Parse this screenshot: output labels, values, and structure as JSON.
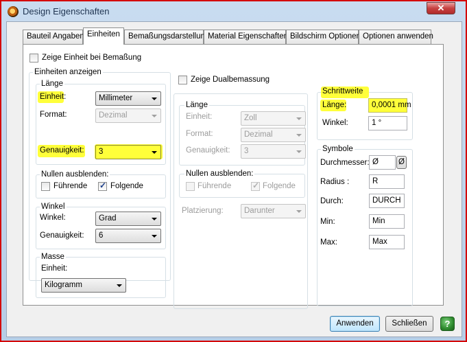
{
  "window": {
    "title": "Design Eigenschaften",
    "close_glyph": "✕"
  },
  "tabs": [
    {
      "label": "Bauteil Angaben"
    },
    {
      "label": "Einheiten"
    },
    {
      "label": "Bemaßungsdarstellung"
    },
    {
      "label": "Material Eigenschaften"
    },
    {
      "label": "Bildschirm Optionen"
    },
    {
      "label": "Optionen anwenden"
    }
  ],
  "left": {
    "show_unit_label": "Zeige Einheit bei Bemaßung",
    "units_group_title": "Einheiten anzeigen",
    "length": {
      "title": "Länge",
      "unit_label": "Einheit:",
      "unit_value": "Millimeter",
      "format_label": "Format:",
      "format_value": "Dezimal",
      "precision_label": "Genauigkeit:",
      "precision_value": "3"
    },
    "zeros": {
      "title": "Nullen ausblenden:",
      "leading": "Führende",
      "trailing": "Folgende",
      "leading_checked": false,
      "trailing_checked": true
    },
    "angle": {
      "title": "Winkel",
      "unit_label": "Winkel:",
      "unit_value": "Grad",
      "precision_label": "Genauigkeit:",
      "precision_value": "6"
    },
    "mass": {
      "title": "Masse",
      "unit_label": "Einheit:",
      "unit_value": "Kilogramm"
    }
  },
  "dual": {
    "show_label": "Zeige Dualbemassung",
    "length": {
      "title": "Länge",
      "unit_label": "Einheit:",
      "unit_value": "Zoll",
      "format_label": "Format:",
      "format_value": "Dezimal",
      "precision_label": "Genauigkeit:",
      "precision_value": "3"
    },
    "zeros": {
      "title": "Nullen ausblenden:",
      "leading": "Führende",
      "trailing": "Folgende",
      "leading_checked": false,
      "trailing_checked": true
    },
    "placement_label": "Platzierung:",
    "placement_value": "Darunter"
  },
  "snap": {
    "title": "Schrittweite",
    "length_label": "Länge:",
    "length_value": "0,0001 mm",
    "angle_label": "Winkel:",
    "angle_value": "1 °"
  },
  "symbols": {
    "title": "Symbole",
    "diameter_label": "Durchmesser:",
    "diameter_value": "Ø",
    "diameter_btn": "Ø",
    "radius_label": "Radius :",
    "radius_value": "R",
    "through_label": "Durch:",
    "through_value": "DURCH",
    "min_label": "Min:",
    "min_value": "Min",
    "max_label": "Max:",
    "max_value": "Max"
  },
  "buttons": {
    "apply": "Anwenden",
    "close": "Schließen",
    "help": "?"
  },
  "colors": {
    "highlight": "#ffff3a",
    "help_green": "#2e8b2e",
    "close_red": "#c74141"
  }
}
